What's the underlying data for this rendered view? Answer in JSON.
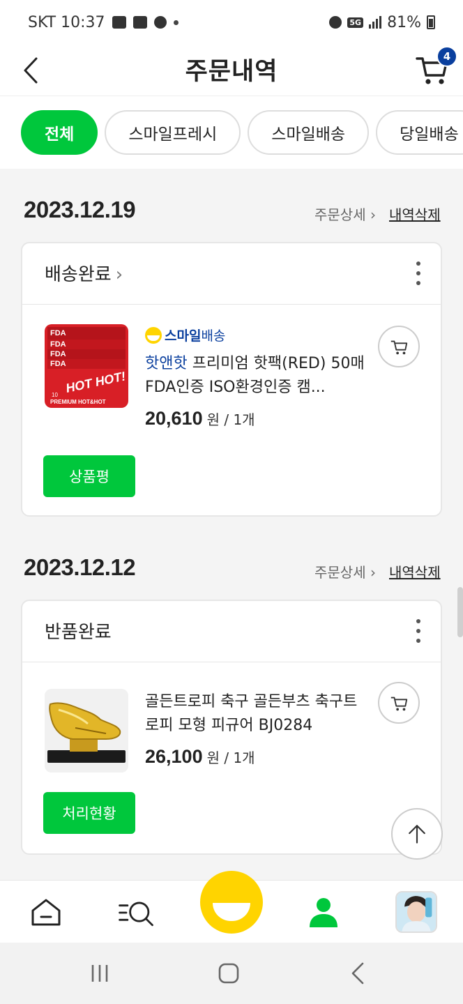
{
  "status_bar": {
    "carrier_time": "SKT 10:37",
    "network": "5G",
    "battery": "81%"
  },
  "header": {
    "title": "주문내역",
    "cart_count": "4"
  },
  "filters": [
    {
      "label": "전체",
      "active": true
    },
    {
      "label": "스마일프레시",
      "active": false
    },
    {
      "label": "스마일배송",
      "active": false
    },
    {
      "label": "당일배송",
      "active": false
    }
  ],
  "orders": [
    {
      "date": "2023.12.19",
      "detail_link": "주문상세 ›",
      "delete_link": "내역삭제",
      "status": "배송완료",
      "brand": "스마일배송",
      "brand_prefix": "스마일",
      "brand_suffix": "배송",
      "seller": "핫앤핫",
      "name": " 프리미엄 핫팩(RED) 50매 FDA인증 ISO환경인증 캠...",
      "price": "20,610",
      "unit": "원 / 1개",
      "action": "상품평",
      "thumb_text": "HOT HOT!",
      "thumb_sub": "PREMIUM HOT&HOT",
      "thumb_badge": "FDA",
      "thumb_count": "10"
    },
    {
      "date": "2023.12.12",
      "detail_link": "주문상세 ›",
      "delete_link": "내역삭제",
      "status": "반품완료",
      "name": "골든트로피 축구 골든부츠 축구트로피 모형 피규어 BJ0284",
      "price": "26,100",
      "unit": "원 / 1개",
      "action": "처리현황"
    }
  ],
  "colors": {
    "accent_green": "#00c73c",
    "brand_blue": "#0a3f9e",
    "smile_yellow": "#ffd400"
  },
  "icons": {
    "back": "chevron-left-icon",
    "cart": "cart-icon",
    "more": "more-vertical-icon",
    "home": "home-icon",
    "menu_search": "menu-search-icon",
    "smile": "smile-icon",
    "my": "person-icon",
    "scroll_top": "arrow-up-icon"
  }
}
